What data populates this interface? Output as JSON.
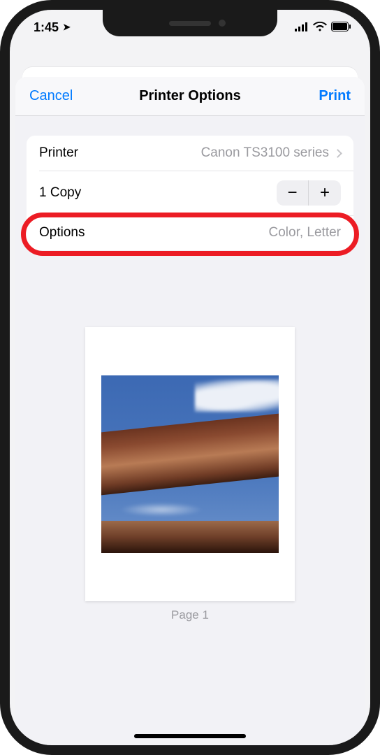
{
  "status": {
    "time": "1:45",
    "location_glyph": "➤"
  },
  "nav": {
    "cancel": "Cancel",
    "title": "Printer Options",
    "print": "Print"
  },
  "rows": {
    "printer_label": "Printer",
    "printer_value": "Canon TS3100 series",
    "copies_label": "1 Copy",
    "options_label": "Options",
    "options_value": "Color, Letter"
  },
  "stepper": {
    "minus": "−",
    "plus": "+"
  },
  "preview": {
    "page_label": "Page 1"
  }
}
